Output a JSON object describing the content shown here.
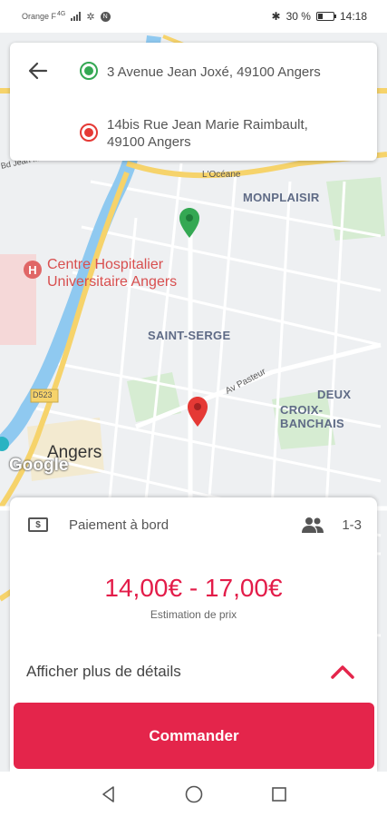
{
  "status_bar": {
    "carrier": "Orange F",
    "network": "4G",
    "battery_text": "30 %",
    "battery_level": 0.3,
    "time": "14:18"
  },
  "map": {
    "districts": [
      "MONPLAISIR",
      "SAINT-SERGE",
      "DEUX",
      "CROIX-BANCHAIS"
    ],
    "poi": {
      "line1": "Centre Hospitalier",
      "line2": "Universitaire Angers"
    },
    "roads": {
      "oceane": "L'Océane",
      "pasteur": "Av Pasteur",
      "d523": "D523",
      "jean_moulin": "Bd Jean Moulin"
    },
    "city": "Angers",
    "google": "Google"
  },
  "addresses": {
    "origin": "3 Avenue Jean Joxé, 49100 Angers",
    "destination_line1": "14bis Rue Jean Marie Raimbault,",
    "destination_line2": "49100 Angers"
  },
  "booking": {
    "payment_label": "Paiement à bord",
    "passengers": "1-3",
    "price": "14,00€ - 17,00€",
    "price_caption": "Estimation de prix",
    "details_label": "Afficher plus de détails",
    "order_button": "Commander"
  },
  "colors": {
    "accent": "#e4254b",
    "price": "#e31c49",
    "origin": "#34a853",
    "destination": "#e53935"
  },
  "icons": [
    "back-arrow-icon",
    "origin-dot-icon",
    "destination-dot-icon",
    "cash-icon",
    "people-icon",
    "chevron-up-icon",
    "map-pin-icon",
    "hospital-icon"
  ]
}
